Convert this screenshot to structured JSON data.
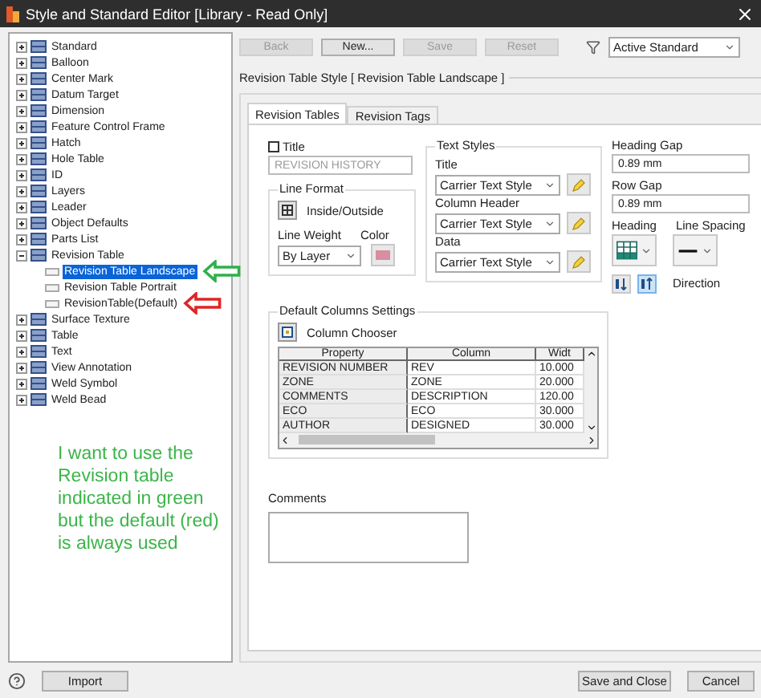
{
  "window": {
    "title": "Style and Standard Editor [Library - Read Only]"
  },
  "tree": [
    {
      "label": "Standard",
      "expanded": false
    },
    {
      "label": "Balloon",
      "expanded": false
    },
    {
      "label": "Center Mark",
      "expanded": false
    },
    {
      "label": "Datum Target",
      "expanded": false
    },
    {
      "label": "Dimension",
      "expanded": false
    },
    {
      "label": "Feature Control Frame",
      "expanded": false
    },
    {
      "label": "Hatch",
      "expanded": false
    },
    {
      "label": "Hole Table",
      "expanded": false
    },
    {
      "label": "ID",
      "expanded": false
    },
    {
      "label": "Layers",
      "expanded": false
    },
    {
      "label": "Leader",
      "expanded": false
    },
    {
      "label": "Object Defaults",
      "expanded": false
    },
    {
      "label": "Parts List",
      "expanded": false
    },
    {
      "label": "Revision Table",
      "expanded": true,
      "children": [
        {
          "label": "Revision Table Landscape",
          "selected": true,
          "arrow": {
            "color": "#2fb04a"
          }
        },
        {
          "label": "Revision Table Portrait",
          "selected": false
        },
        {
          "label": "RevisionTable(Default)",
          "selected": false,
          "arrow": {
            "color": "#e02424"
          }
        }
      ]
    },
    {
      "label": "Surface Texture",
      "expanded": false
    },
    {
      "label": "Table",
      "expanded": false
    },
    {
      "label": "Text",
      "expanded": false
    },
    {
      "label": "View Annotation",
      "expanded": false
    },
    {
      "label": "Weld Symbol",
      "expanded": false
    },
    {
      "label": "Weld Bead",
      "expanded": false
    }
  ],
  "note": "I want to use the Revision table indicated in green but the default (red) is always used",
  "import_button": "Import",
  "toolbar": {
    "buttons": [
      {
        "label": "Back",
        "disabled": true
      },
      {
        "label": "New...",
        "disabled": false
      },
      {
        "label": "Save",
        "disabled": true
      },
      {
        "label": "Reset",
        "disabled": true
      }
    ],
    "standard_filter": "Active Standard"
  },
  "style_header": "Revision Table Style [ Revision Table Landscape ]",
  "tabs": [
    {
      "label": "Revision Tables",
      "selected": true
    },
    {
      "label": "Revision Tags",
      "selected": false
    }
  ],
  "title_option": {
    "label": "Title",
    "checked": false,
    "value": "REVISION HISTORY"
  },
  "line_format": {
    "title": "Line Format",
    "button": "Inside/Outside",
    "weight_label": "Line Weight",
    "weight": "By Layer",
    "color_label": "Color"
  },
  "text_styles": {
    "title": "Text Styles",
    "rows": [
      {
        "label": "Title",
        "value": "Carrier Text Style"
      },
      {
        "label": "Column Header",
        "value": "Carrier Text Style"
      },
      {
        "label": "Data",
        "value": "Carrier Text Style"
      }
    ]
  },
  "heading_gap": {
    "label": "Heading Gap",
    "value": "0.89 mm"
  },
  "row_gap": {
    "label": "Row Gap",
    "value": "0.89 mm"
  },
  "heading_label": "Heading",
  "line_spacing_label": "Line Spacing",
  "direction": {
    "label": "Direction",
    "buttons": [
      {
        "selected": false
      },
      {
        "selected": true
      }
    ]
  },
  "columns_settings": {
    "title": "Default Columns Settings",
    "chooser": "Column Chooser",
    "table": {
      "columns": [
        "Property",
        "Column",
        "Widt"
      ],
      "rows": [
        [
          "REVISION NUMBER",
          "REV",
          "10.000"
        ],
        [
          "ZONE",
          "ZONE",
          "20.000"
        ],
        [
          "COMMENTS",
          "DESCRIPTION",
          "120.00"
        ],
        [
          "ECO",
          "ECO",
          "30.000"
        ],
        [
          "AUTHOR",
          "DESIGNED",
          "30.000"
        ]
      ]
    }
  },
  "comments": {
    "label": "Comments"
  },
  "footer_buttons": [
    "Save and Close",
    "Cancel"
  ]
}
